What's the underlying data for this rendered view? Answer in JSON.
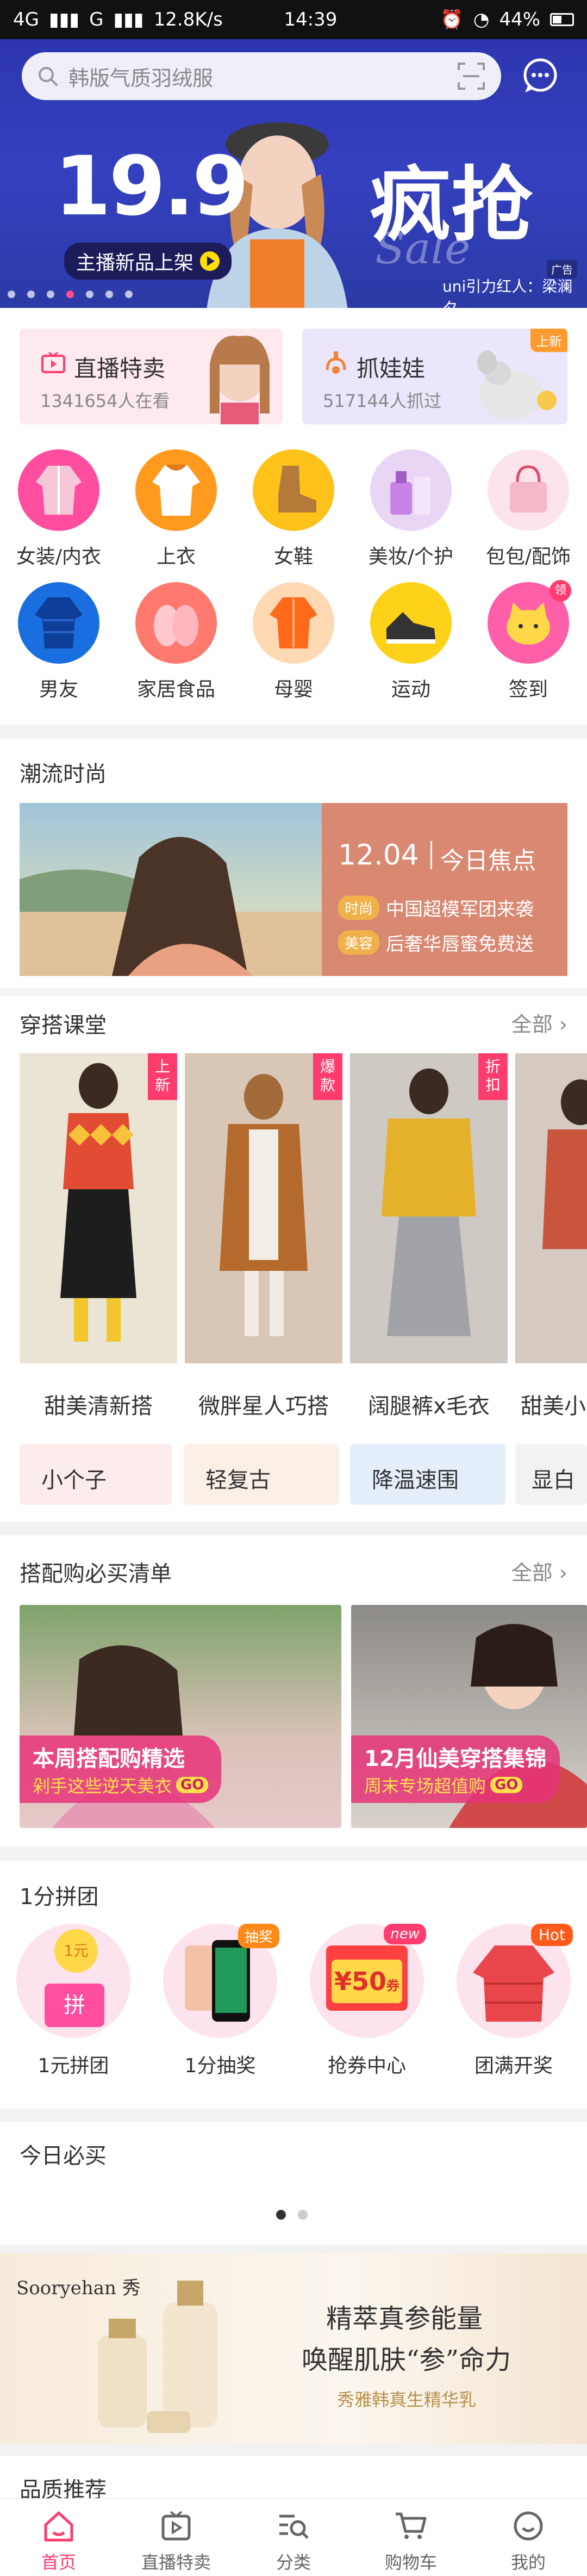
{
  "status_bar": {
    "network": "4G",
    "carrier": "G",
    "speed": "12.8K/s",
    "time": "14:39",
    "battery": "44%"
  },
  "search": {
    "placeholder": "韩版气质羽绒服"
  },
  "hero": {
    "price": "19.9",
    "headline": "疯抢",
    "script_word": "Sale",
    "tag": "主播新品上架",
    "credit": "uni引力红人：梁澜夕",
    "ad_label": "广告"
  },
  "live_cards": [
    {
      "title": "直播特卖",
      "sub": "1341654人在看"
    },
    {
      "title": "抓娃娃",
      "sub": "517144人抓过",
      "badge": "上新"
    }
  ],
  "categories": [
    {
      "label": "女装/内衣"
    },
    {
      "label": "上衣"
    },
    {
      "label": "女鞋"
    },
    {
      "label": "美妆/个护"
    },
    {
      "label": "包包/配饰"
    },
    {
      "label": "男友"
    },
    {
      "label": "家居食品"
    },
    {
      "label": "母婴"
    },
    {
      "label": "运动"
    },
    {
      "label": "签到"
    }
  ],
  "sign_badge": "领",
  "trend": {
    "title": "潮流时尚",
    "date": "12.04",
    "focus": "今日焦点",
    "items": [
      {
        "tag": "时尚",
        "text": "中国超模军团来袭"
      },
      {
        "tag": "美容",
        "text": "后奢华唇蜜免费送"
      }
    ]
  },
  "outfit": {
    "title": "穿搭课堂",
    "more": "全部",
    "items": [
      {
        "caption": "甜美清新搭",
        "ribbon": "上新"
      },
      {
        "caption": "微胖星人巧搭",
        "ribbon": "爆款"
      },
      {
        "caption": "阔腿裤x毛衣",
        "ribbon": "折扣"
      },
      {
        "caption": "甜美小"
      }
    ],
    "chips": [
      "小个子",
      "轻复古",
      "降温速围",
      "显白"
    ]
  },
  "must_buy": {
    "title": "搭配购必买清单",
    "more": "全部",
    "cards": [
      {
        "title": "本周搭配购精选",
        "sub": "剁手这些逆天美衣",
        "go": "GO"
      },
      {
        "title": "12月仙美穿搭集锦",
        "sub": "周末专场超值购",
        "go": "GO"
      }
    ]
  },
  "group_buy": {
    "title": "1分拼团",
    "items": [
      {
        "label": "1元拼团",
        "coin": "1元",
        "stamp": "拼"
      },
      {
        "label": "1分抽奖",
        "badge": "抽奖"
      },
      {
        "label": "抢券中心",
        "badge": "new",
        "value": "¥50",
        "unit": "券"
      },
      {
        "label": "团满开奖",
        "badge": "Hot"
      }
    ]
  },
  "today": {
    "title": "今日必买"
  },
  "ad": {
    "brand": "Sooryehan 秀",
    "line1": "精萃真参能量",
    "line2": "唤醒肌肤“参”命力",
    "line3": "秀雅韩真生精华乳"
  },
  "next_section": {
    "title": "品质推荐"
  },
  "tabs": [
    {
      "label": "首页"
    },
    {
      "label": "直播特卖"
    },
    {
      "label": "分类"
    },
    {
      "label": "购物车"
    },
    {
      "label": "我的"
    }
  ],
  "colors": {
    "accent": "#ff3c6e",
    "hero_blue": "#2a33a8",
    "trend_card": "#d98872"
  }
}
